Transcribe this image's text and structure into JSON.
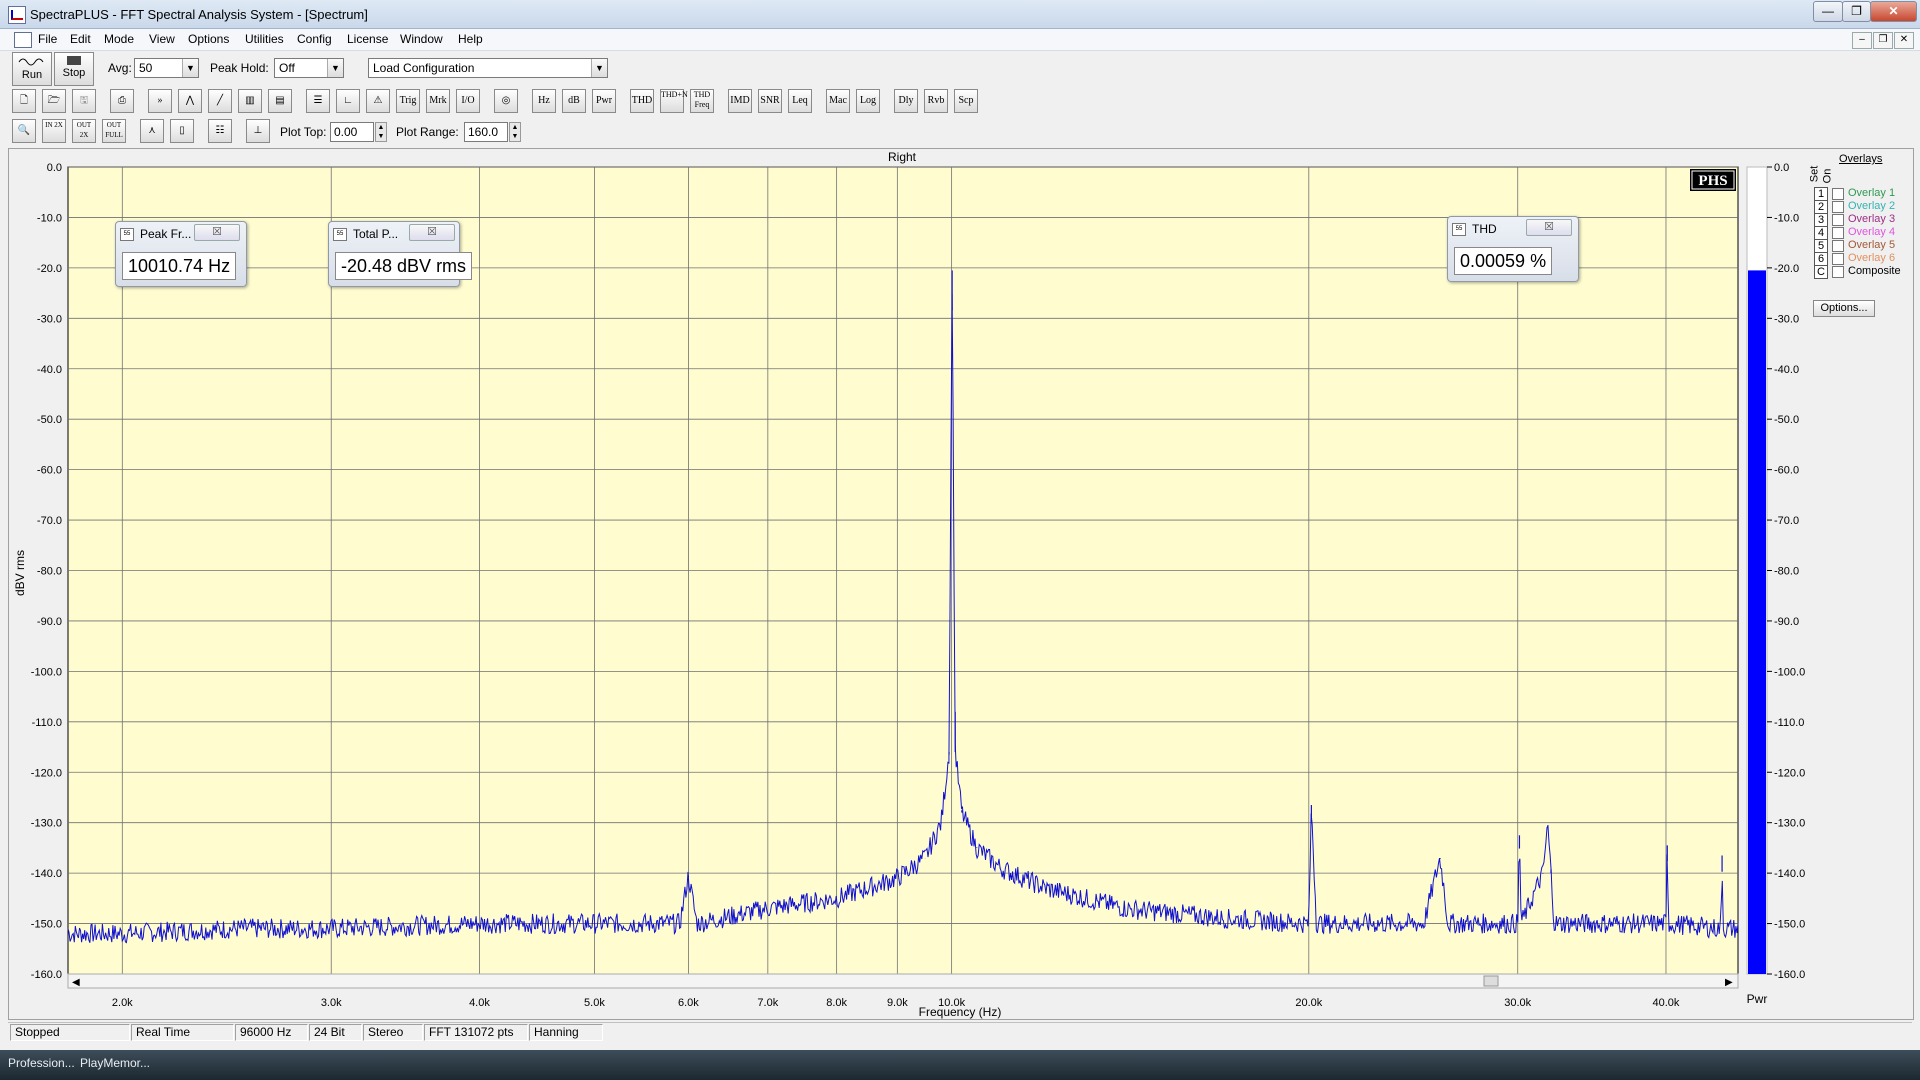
{
  "window": {
    "title": "SpectraPLUS - FFT Spectral Analysis System - [Spectrum]",
    "controls": [
      "—",
      "❐",
      "✕"
    ],
    "child_controls": [
      "–",
      "❐",
      "✕"
    ]
  },
  "menu": [
    "File",
    "Edit",
    "Mode",
    "View",
    "Options",
    "Utilities",
    "Config",
    "License",
    "Window",
    "Help"
  ],
  "toolbar1": {
    "run_label": "Run",
    "stop_label": "Stop",
    "avg_label": "Avg:",
    "avg_value": "50",
    "peakhold_label": "Peak Hold:",
    "peakhold_value": "Off",
    "config_value": "Load Configuration"
  },
  "toolbar2": {
    "buttons": [
      "Trig",
      "Mrk",
      "I/O",
      "Hz",
      "dB",
      "Pwr",
      "THD",
      "THD+N",
      "THD Freq",
      "IMD",
      "SNR",
      "Leq",
      "Mac",
      "Log",
      "Dly",
      "Rvb",
      "Scp"
    ]
  },
  "toolbar3": {
    "zoom_labels": [
      "IN 2X",
      "OUT 2X",
      "OUT FULL"
    ],
    "plot_top_label": "Plot Top:",
    "plot_top_value": "0.00",
    "plot_range_label": "Plot Range:",
    "plot_range_value": "160.0"
  },
  "meters": {
    "peak_freq": {
      "title": "Peak Fr...",
      "value": "10010.74 Hz",
      "close": "☒"
    },
    "total_power": {
      "title": "Total P...",
      "value": "-20.48 dBV rms",
      "close": "☒"
    },
    "thd": {
      "title": "THD",
      "value": "0.00059 %",
      "close": "☒"
    }
  },
  "overlays": {
    "title": "Overlays",
    "set_label": "Set",
    "on_label": "On",
    "items": [
      {
        "num": "1",
        "label": "Overlay 1",
        "color": "#2e9a52"
      },
      {
        "num": "2",
        "label": "Overlay 2",
        "color": "#33b3b3"
      },
      {
        "num": "3",
        "label": "Overlay 3",
        "color": "#9c2f86"
      },
      {
        "num": "4",
        "label": "Overlay 4",
        "color": "#e055e0"
      },
      {
        "num": "5",
        "label": "Overlay 5",
        "color": "#a25838"
      },
      {
        "num": "6",
        "label": "Overlay 6",
        "color": "#e09060"
      },
      {
        "num": "C",
        "label": "Composite",
        "color": "#000000"
      }
    ],
    "options_label": "Options..."
  },
  "status": {
    "cells": [
      "Stopped",
      "Real Time",
      "96000 Hz",
      "24 Bit",
      "Stereo",
      "FFT 131072 pts",
      "Hanning"
    ]
  },
  "taskbar": {
    "items": [
      "Profession...",
      "PlayMemor..."
    ]
  },
  "chart_data": {
    "type": "line",
    "title": "Right",
    "xlabel": "Frequency (Hz)",
    "ylabel": "dBV rms",
    "x_scale": "log",
    "xlim": [
      1800,
      46000
    ],
    "ylim": [
      -160,
      0
    ],
    "y_ticks": [
      "0.0",
      "-10.0",
      "-20.0",
      "-30.0",
      "-40.0",
      "-50.0",
      "-60.0",
      "-70.0",
      "-80.0",
      "-90.0",
      "-100.0",
      "-110.0",
      "-120.0",
      "-130.0",
      "-140.0",
      "-150.0",
      "-160.0"
    ],
    "x_ticks": [
      {
        "v": 2000,
        "label": "2.0k"
      },
      {
        "v": 3000,
        "label": "3.0k"
      },
      {
        "v": 4000,
        "label": "4.0k"
      },
      {
        "v": 5000,
        "label": "5.0k"
      },
      {
        "v": 6000,
        "label": "6.0k"
      },
      {
        "v": 7000,
        "label": "7.0k"
      },
      {
        "v": 8000,
        "label": "8.0k"
      },
      {
        "v": 9000,
        "label": "9.0k"
      },
      {
        "v": 10000,
        "label": "10.0k"
      },
      {
        "v": 20000,
        "label": "20.0k"
      },
      {
        "v": 30000,
        "label": "30.0k"
      },
      {
        "v": 40000,
        "label": "40.0k"
      }
    ],
    "grid": true,
    "background": "#fffdd0",
    "line_color": "#1010d0",
    "series": [
      {
        "x": [
          1800,
          2000,
          2500,
          3000,
          4000,
          5000,
          5900,
          6000,
          6100,
          7000,
          8000,
          9000,
          9500,
          9800,
          9950,
          10010,
          10070,
          10200,
          10500,
          11000,
          12000,
          14000,
          17000,
          20000,
          20100,
          20300,
          25000,
          25800,
          26000,
          26200,
          30000,
          30100,
          30200,
          31500,
          31800,
          32000,
          32200,
          40000,
          40100,
          40200,
          44500,
          44600,
          44700,
          46000
        ],
        "y": [
          -152,
          -152,
          -151,
          -151,
          -150,
          -150,
          -150,
          -140.5,
          -150,
          -147,
          -145,
          -141,
          -137,
          -130,
          -116,
          -20.5,
          -116,
          -128,
          -135,
          -139,
          -143,
          -147,
          -149,
          -150,
          -126.5,
          -150,
          -150,
          -137,
          -143,
          -150,
          -150,
          -132.5,
          -150,
          -140,
          -130.5,
          -140,
          -150,
          -150,
          -134.5,
          -150,
          -151,
          -136.5,
          -151,
          -151
        ]
      }
    ],
    "pwr_meter": {
      "label": "Pwr",
      "value": -20.5,
      "color": "#0000ff"
    },
    "logo": "PHS"
  }
}
